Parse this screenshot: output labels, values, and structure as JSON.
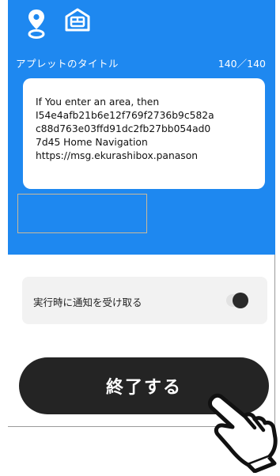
{
  "header": {
    "icons": [
      "location-pin-icon",
      "home-icon"
    ],
    "applet_title_label": "アプレットのタイトル",
    "char_count": "140／140"
  },
  "title_field": {
    "value_line1": "If You enter an area, then",
    "value_line2": "I54e4afb21b6e12f769f2736b9c582a",
    "value_line3": "c88d763e03ffd91dc2fb27bb054ad0",
    "value_line4": "7d45 Home Navigation",
    "value_line5": "https://msg.ekurashibox.panason"
  },
  "notification": {
    "label": "実行時に通知を受け取る",
    "toggle_on": false
  },
  "finish_button": {
    "label": "終了する"
  },
  "colors": {
    "panel_blue": "#1e88f0",
    "button_dark": "#242424",
    "row_gray": "#f2f2f2"
  },
  "overlay": {
    "pointer": "pointing-hand-icon"
  }
}
